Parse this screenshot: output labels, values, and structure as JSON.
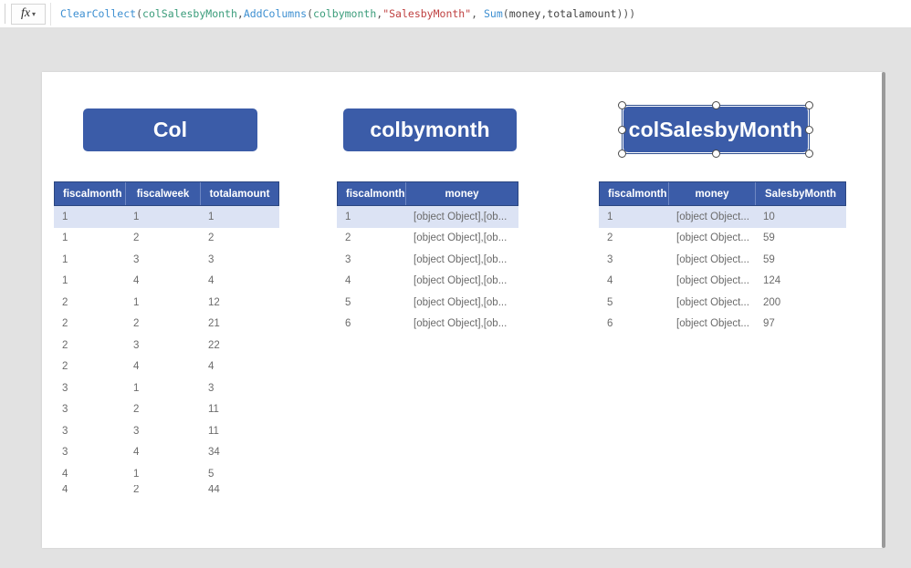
{
  "formula_bar": {
    "fx_label": "fx",
    "chevron": "⌄",
    "formula_text": "ClearCollect(colSalesbyMonth,AddColumns(colbymonth,\"SalesbyMonth\", Sum(money,totalamount)))",
    "tokens": [
      {
        "t": "ClearCollect",
        "k": "fn"
      },
      {
        "t": "(",
        "k": "punct"
      },
      {
        "t": "colSalesbyMonth",
        "k": "ident"
      },
      {
        "t": ",",
        "k": "punct"
      },
      {
        "t": "AddColumns",
        "k": "fn"
      },
      {
        "t": "(",
        "k": "punct"
      },
      {
        "t": "colbymonth",
        "k": "ident"
      },
      {
        "t": ",",
        "k": "punct"
      },
      {
        "t": "\"SalesbyMonth\"",
        "k": "str"
      },
      {
        "t": ", ",
        "k": "punct"
      },
      {
        "t": "Sum",
        "k": "fn"
      },
      {
        "t": "(",
        "k": "punct"
      },
      {
        "t": "money",
        "k": "plain"
      },
      {
        "t": ",",
        "k": "punct"
      },
      {
        "t": "totalamount",
        "k": "plain"
      },
      {
        "t": ")))",
        "k": "punct"
      }
    ]
  },
  "labels": {
    "col": "Col",
    "colbymonth": "colbymonth",
    "colsalesbymonth": "colSalesbyMonth"
  },
  "colors": {
    "accent_blue": "#3b5ca8",
    "header_border": "#2b4680",
    "row_selected": "#dce3f4",
    "canvas_bg": "#ffffff",
    "editor_bg": "#e2e2e2",
    "cell_text": "#6b6b6b"
  },
  "tables": {
    "col": {
      "columns": [
        "fiscalmonth",
        "fiscalweek",
        "totalamount"
      ],
      "rows": [
        [
          "1",
          "1",
          "1"
        ],
        [
          "1",
          "2",
          "2"
        ],
        [
          "1",
          "3",
          "3"
        ],
        [
          "1",
          "4",
          "4"
        ],
        [
          "2",
          "1",
          "12"
        ],
        [
          "2",
          "2",
          "21"
        ],
        [
          "2",
          "3",
          "22"
        ],
        [
          "2",
          "4",
          "4"
        ],
        [
          "3",
          "1",
          "3"
        ],
        [
          "3",
          "2",
          "11"
        ],
        [
          "3",
          "3",
          "11"
        ],
        [
          "3",
          "4",
          "34"
        ],
        [
          "4",
          "1",
          "5"
        ],
        [
          "4",
          "2",
          "44"
        ]
      ],
      "selected_row_index": 0,
      "clipped_last_row": true
    },
    "colbymonth": {
      "columns": [
        "fiscalmonth",
        "money"
      ],
      "rows": [
        [
          "1",
          "[object Object],[ob..."
        ],
        [
          "2",
          "[object Object],[ob..."
        ],
        [
          "3",
          "[object Object],[ob..."
        ],
        [
          "4",
          "[object Object],[ob..."
        ],
        [
          "5",
          "[object Object],[ob..."
        ],
        [
          "6",
          "[object Object],[ob..."
        ]
      ],
      "selected_row_index": 0,
      "clipped_last_row": false
    },
    "colsalesbymonth": {
      "columns": [
        "fiscalmonth",
        "money",
        "SalesbyMonth"
      ],
      "rows": [
        [
          "1",
          "[object Object...",
          "10"
        ],
        [
          "2",
          "[object Object...",
          "59"
        ],
        [
          "3",
          "[object Object...",
          "59"
        ],
        [
          "4",
          "[object Object...",
          "124"
        ],
        [
          "5",
          "[object Object...",
          "200"
        ],
        [
          "6",
          "[object Object...",
          "97"
        ]
      ],
      "selected_row_index": 0,
      "clipped_last_row": false
    }
  },
  "selection": {
    "target": "colSalesbyMonth label",
    "handle_count": 8
  }
}
